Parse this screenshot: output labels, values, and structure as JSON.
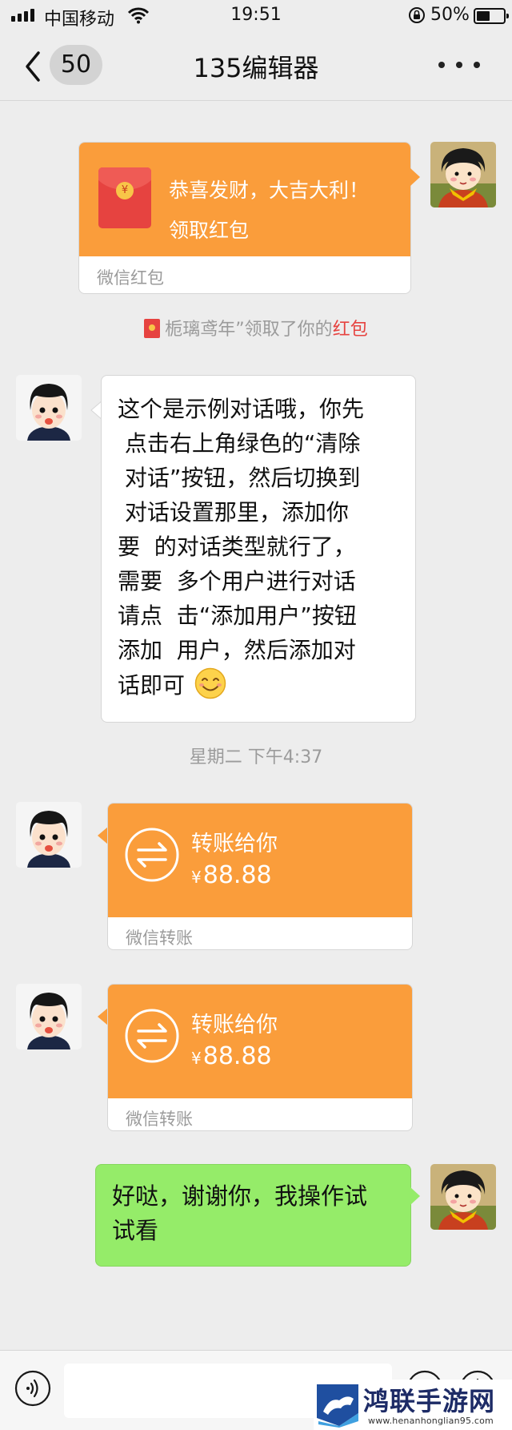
{
  "status_bar": {
    "carrier": "中国移动",
    "time": "19:51",
    "battery": "50%",
    "battery_level": 0.5
  },
  "nav": {
    "unread_count": "50",
    "title": "135编辑器"
  },
  "messages": [
    {
      "type": "red_packet",
      "side": "right",
      "greeting": "恭喜发财，大吉大利！",
      "action": "领取红包",
      "footer": "微信红包",
      "coin_symbol": "¥"
    },
    {
      "type": "system",
      "text": "栀璃鸢年”领取了你的",
      "link": "红包"
    },
    {
      "type": "text",
      "side": "left",
      "text": "这个是示例对话哦，你先\n 点击右上角绿色的“清除\n 对话”按钮，然后切换到\n 对话设置那里，添加你\n要  的对话类型就行了，\n需要  多个用户进行对话\n请点  击“添加用户”按钮\n添加  用户，然后添加对\n话即可"
    },
    {
      "type": "timestamp",
      "text": "星期二 下午4:37"
    },
    {
      "type": "transfer",
      "side": "left",
      "label": "转账给你",
      "currency": "¥",
      "amount": "88.88",
      "footer": "微信转账"
    },
    {
      "type": "transfer",
      "side": "left",
      "label": "转账给你",
      "currency": "¥",
      "amount": "88.88",
      "footer": "微信转账"
    },
    {
      "type": "text",
      "side": "right",
      "text": "好哒，谢谢你，我操作试\n试看"
    }
  ],
  "watermark": {
    "name": "鸿联手游网",
    "url": "www.henanhonglian95.com"
  },
  "colors": {
    "background": "#ededed",
    "red_packet_orange": "#fa9d3b",
    "my_bubble_green": "#95ec69",
    "link_red": "#e64340",
    "meta_gray": "#9b9b9b"
  }
}
